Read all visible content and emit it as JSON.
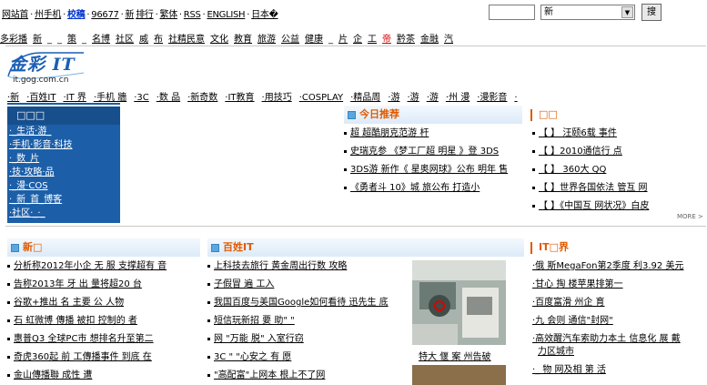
{
  "topbar": {
    "links": [
      "网站首",
      "·",
      "州手机",
      "·",
      "校稿",
      "·",
      "96677",
      "·",
      "新",
      "排行",
      "·",
      "繁体",
      "·",
      "RSS",
      "·",
      "ENGLISH",
      "·",
      "日本�"
    ],
    "search_select_value": "新",
    "search_button": "搜"
  },
  "nav": {
    "items": [
      "多彩播",
      "新",
      "_",
      "_",
      "策",
      "_",
      "名博",
      "社区",
      "威",
      "布",
      "社精民意",
      "文化",
      "教育",
      "旅游",
      "公益",
      "健康",
      "_",
      "片",
      "企",
      "工",
      "帝",
      "黔茶",
      "金融",
      "汽"
    ]
  },
  "logo": {
    "title": "金彩 IT",
    "sub": "it.gog.com.cn"
  },
  "channel": {
    "items": [
      "·新",
      "·百姓IT",
      "·IT 界",
      "·手机 牆",
      "·3C",
      "·数 品",
      "·新奇数",
      "·IT教育",
      "·用技巧",
      "·COSPLAY",
      "·精品周",
      "·游",
      "·游",
      "·游",
      "·州 漫",
      "·漫影音",
      "·"
    ]
  },
  "leftbox": {
    "head": "□□□",
    "rows": [
      "·_生活·游_",
      "·手机·影音·科技",
      "·_数_片",
      "·技·攻略·品",
      "·_漫·COS",
      "·_新_首_博客",
      "·社区·_·_"
    ]
  },
  "today": {
    "title": "今日推荐",
    "items": [
      "超 超酷朋克范游 杆",
      "史瑞克参 《梦工厂超 明星 》登 3DS",
      "3DS游 新作《 星奥网球》公布 明年 售",
      "《勇者斗 10》城 旅公布 打造小"
    ]
  },
  "right_top": {
    "title": "□□",
    "items": [
      "【 】 汪颐6载 事件",
      "【 】2010通信行 点",
      "【 】 360大 QQ",
      "【 】世界各国依法 管互 网",
      "【 】《中国互 网状况》白皮"
    ],
    "more": "MORE >"
  },
  "news": {
    "title": "新□",
    "items": [
      "分析称2012年小企 无 服 支撑超有 音",
      "告称2013年 牙 出 量将超20 台",
      "谷歌+推出 名 主要 公 人物",
      "石 虹微博 傳播 被扣 控制的 者",
      "惠普Q3 全球PC市 想排名升至第二",
      "奇虎360起 前 工傳播事件 到底 在",
      "金山傳播聯 成性 遭"
    ]
  },
  "baixing": {
    "title": "百姓IT",
    "items": [
      "上科技去旅行 黄金周出行数 攻略",
      "子假冒 遍 工入",
      "我国百度与美国Google如何看待 迅先生 底",
      "短信玩新招 要 助\" \"",
      "网 \"万能 脱\" 入室行窃",
      "3C \" \"心安之 有 愿",
      "\"高配富\"上网本 根上不了网"
    ],
    "photo_caption": "特大 偃 案 州告破"
  },
  "itjie": {
    "title": "IT□界",
    "items": [
      "·俄 斯MegaFon第2季度 利3.92 美元",
      "·甘心 掏 楼苹果排第一",
      "·百度富滑 州企 育",
      "·九 会则 通信\"封网\"",
      "·高效醒汽车索助力本土 信息化 展 戴",
      "力区城市",
      "·_ 物 网及相 第 活"
    ]
  }
}
